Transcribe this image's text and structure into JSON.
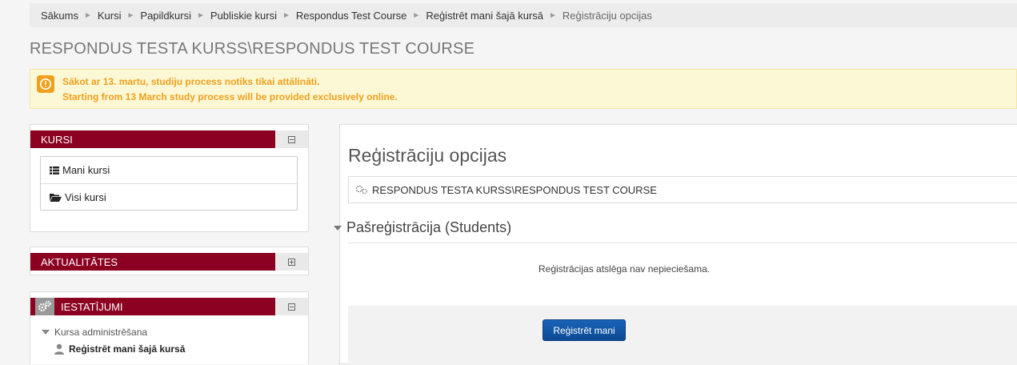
{
  "breadcrumb": [
    "Sākums",
    "Kursi",
    "Papildkursi",
    "Publiskie kursi",
    "Respondus Test Course",
    "Reģistrēt mani šajā kursā"
  ],
  "breadcrumb_current": "Reģistrāciju opcijas",
  "breadcrumb_separator": "►",
  "page_title": "RESPONDUS TESTA KURSS\\RESPONDUS TEST COURSE",
  "notice": {
    "line1": "Sākot ar 13. martu, studiju process notiks tikai attālināti.",
    "line2": "Starting from 13 March study process will be provided exclusively online.",
    "icon": "exclamation-icon",
    "color": "#f0a01d"
  },
  "blocks": {
    "kursi": {
      "title": "KURSI",
      "items": [
        {
          "label": "Mani kursi",
          "icon": "list-icon"
        },
        {
          "label": "Visi kursi",
          "icon": "folder-open-icon"
        }
      ]
    },
    "aktualitates": {
      "title": "AKTUALITĀTES"
    },
    "iestatijumi": {
      "title": "IESTATĪJUMI",
      "admin_label": "Kursa administrēšana",
      "enrol_link": "Reģistrēt mani šajā kursā"
    }
  },
  "main": {
    "heading": "Reģistrāciju opcijas",
    "course_name": "RESPONDUS TESTA KURSS\\RESPONDUS TEST COURSE",
    "self_enrol_title": "Pašreģistrācija (Students)",
    "key_note": "Reģistrācijas atslēga nav nepieciešama.",
    "enrol_button": "Reģistrēt mani"
  },
  "colors": {
    "block_header": "#8b0020",
    "primary_button": "#0c53a3"
  }
}
